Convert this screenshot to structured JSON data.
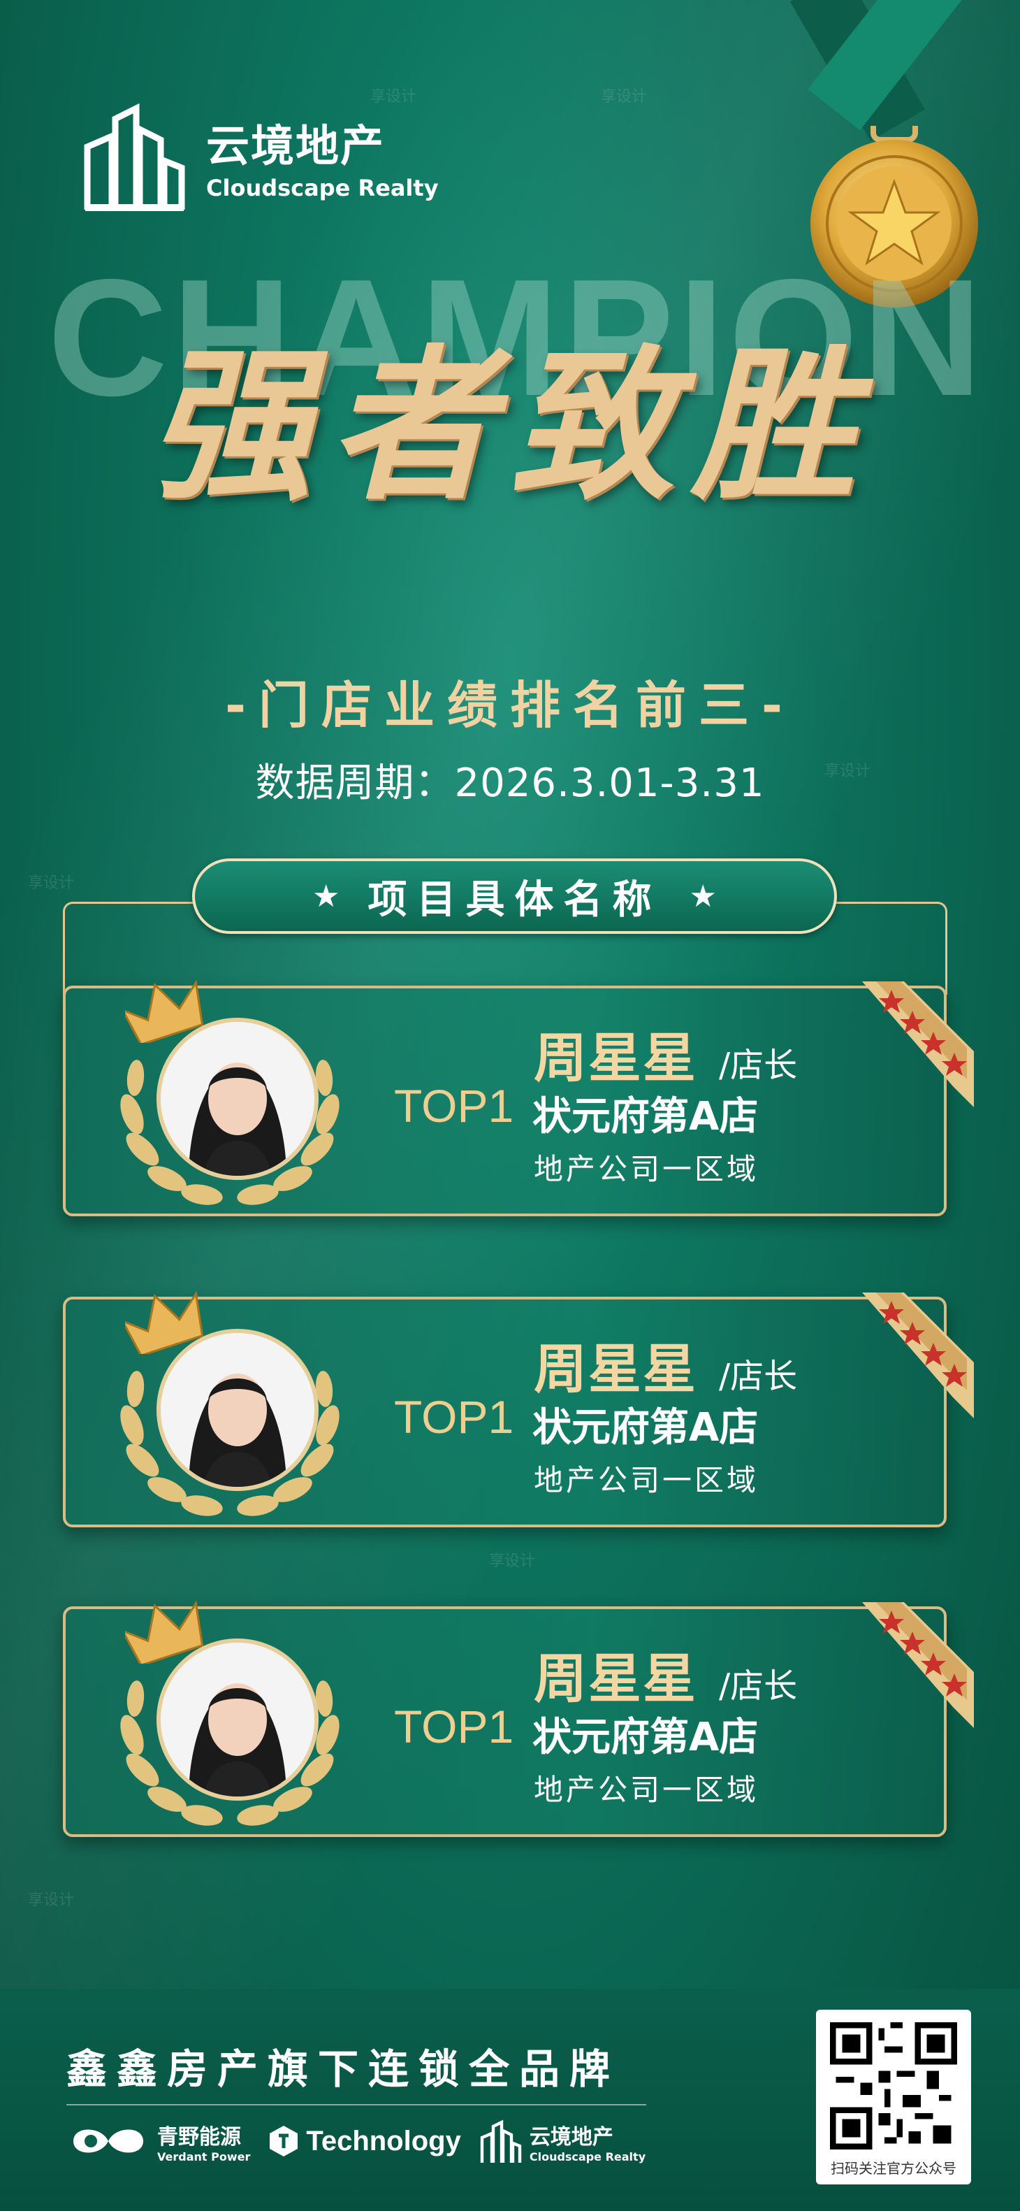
{
  "brand": {
    "cn": "云境地产",
    "en": "Cloudscape Realty"
  },
  "hero": {
    "bg_word": "CHAMPION",
    "headline": "强者致胜",
    "subtitle": "-门店业绩排名前三-",
    "period": "数据周期：2026.3.01-3.31"
  },
  "section": {
    "title": "项目具体名称",
    "star": "★"
  },
  "cards": [
    {
      "rank": "TOP1",
      "name": "周星星",
      "role": "/店长",
      "store": "状元府第A店",
      "region": "地产公司一区域"
    },
    {
      "rank": "TOP1",
      "name": "周星星",
      "role": "/店长",
      "store": "状元府第A店",
      "region": "地产公司一区域"
    },
    {
      "rank": "TOP1",
      "name": "周星星",
      "role": "/店长",
      "store": "状元府第A店",
      "region": "地产公司一区域"
    }
  ],
  "footer": {
    "slogan": "鑫鑫房产旗下连锁全品牌",
    "logos": [
      {
        "cn": "青野能源",
        "en": "Verdant Power"
      },
      {
        "big": "Technology"
      },
      {
        "cn": "云境地产",
        "en": "Cloudscape Realty"
      }
    ],
    "qr_caption": "扫码关注官方公众号"
  },
  "watermark": "享设计",
  "colors": {
    "bg": "#0c6f5a",
    "gold": "#e9c896",
    "frame": "#d9bb84",
    "badge_red": "#c8322a"
  }
}
